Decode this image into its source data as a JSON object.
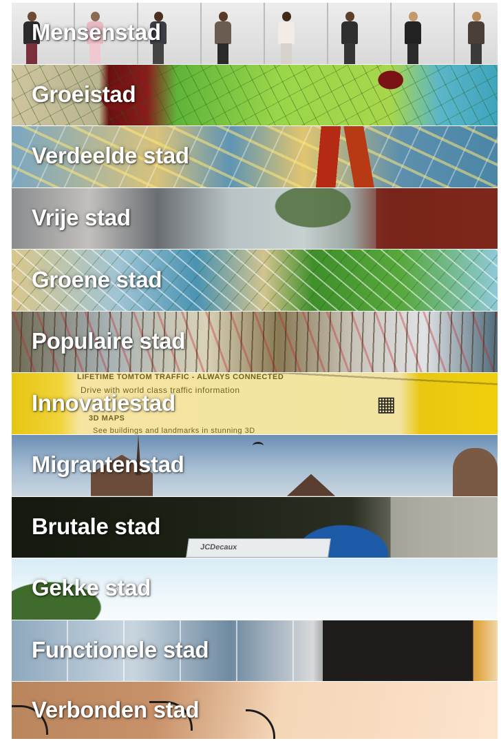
{
  "menu": {
    "items": [
      {
        "label": "Mensenstad"
      },
      {
        "label": "Groeistad"
      },
      {
        "label": "Verdeelde stad"
      },
      {
        "label": "Vrije stad"
      },
      {
        "label": "Groene stad"
      },
      {
        "label": "Populaire stad"
      },
      {
        "label": "Innovatiestad"
      },
      {
        "label": "Migrantenstad"
      },
      {
        "label": "Brutale stad"
      },
      {
        "label": "Gekke stad"
      },
      {
        "label": "Functionele stad"
      },
      {
        "label": "Verbonden stad"
      }
    ]
  },
  "innovatie_sign": {
    "line1": "LIFETIME TOMTOM TRAFFIC - ALWAYS CONNECTED",
    "line2": "Drive with world class traffic information",
    "line3": "3D MAPS",
    "line4": "See buildings and landmarks in stunning 3D"
  },
  "brutale_billboard": {
    "text": "JCDecaux"
  },
  "colors": {
    "label_text": "#ffffff",
    "page_background": "#ffffff"
  }
}
